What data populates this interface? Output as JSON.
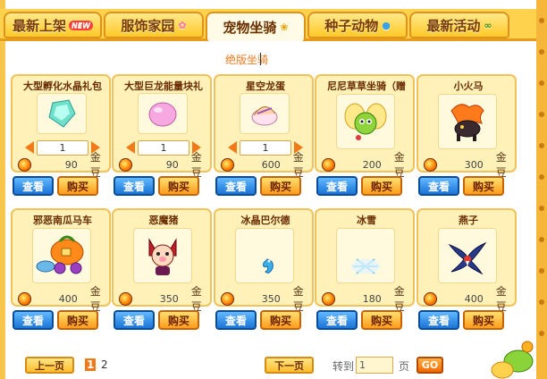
{
  "tabs": [
    {
      "label": "最新上架",
      "badge": "NEW"
    },
    {
      "label": "服饰家园",
      "badge": ""
    },
    {
      "label": "宠物坐骑",
      "badge": ""
    },
    {
      "label": "种子动物",
      "badge": ""
    },
    {
      "label": "最新活动",
      "badge": ""
    }
  ],
  "section_title": "绝版坐骑",
  "currency_unit": "金豆",
  "view_label": "查看",
  "buy_label": "购买",
  "items": [
    {
      "name": "大型孵化水晶礼包",
      "price": "90",
      "qty": "1",
      "icon": "crystal-icon"
    },
    {
      "name": "大型巨龙能量块礼",
      "price": "90",
      "qty": "1",
      "icon": "pink-egg-icon"
    },
    {
      "name": "星空龙蛋",
      "price": "600",
      "qty": "1",
      "icon": "dragon-egg-icon"
    },
    {
      "name": "尼尼草草坐骑（赠",
      "price": "200",
      "icon": "green-fairy-icon"
    },
    {
      "name": "小火马",
      "price": "300",
      "icon": "fire-horse-icon"
    },
    {
      "name": "邪恶南瓜马车",
      "price": "400",
      "icon": "pumpkin-carriage-icon"
    },
    {
      "name": "恶魔猪",
      "price": "350",
      "icon": "demon-pig-icon"
    },
    {
      "name": "冰晶巴尔德",
      "price": "350",
      "icon": "ice-seahorse-icon"
    },
    {
      "name": "冰雪",
      "price": "180",
      "icon": "snowflake-icon"
    },
    {
      "name": "燕子",
      "price": "400",
      "icon": "swallow-icon"
    }
  ],
  "pager": {
    "prev": "上一页",
    "next": "下一页",
    "pages": [
      "1",
      "2"
    ],
    "current": "1",
    "goto_label": "转到",
    "goto_value": "1",
    "page_suffix": "页",
    "go": "GO"
  }
}
